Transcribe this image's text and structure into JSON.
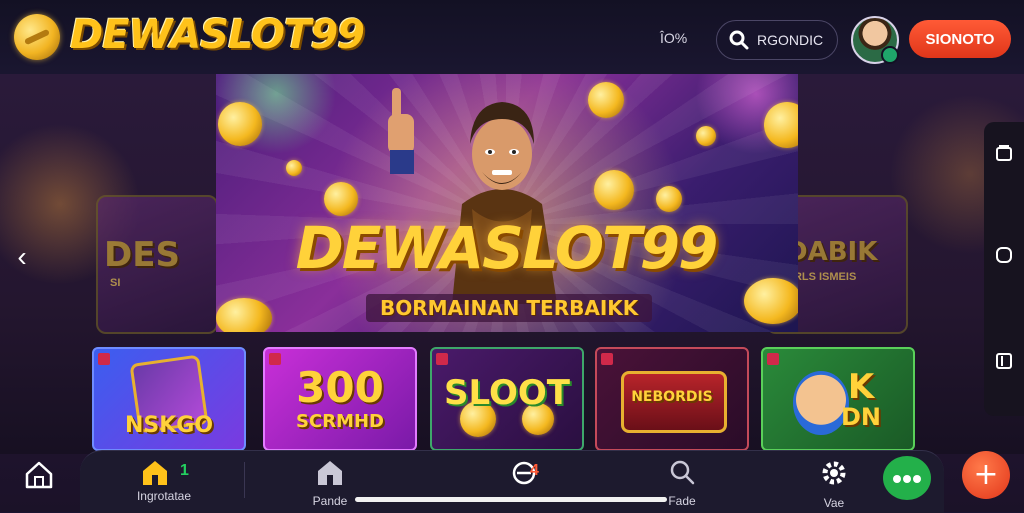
{
  "header": {
    "logo_text": "DEWASLOT99",
    "percent": "ÎO%",
    "search_label": "RGONDIC",
    "cta_label": "SIONOTO"
  },
  "hero": {
    "title": "DEWASLOT99",
    "subtitle": "BORMAINAN TERBAIKK"
  },
  "side_cards": {
    "left_title": "DES",
    "left_sub": "SI",
    "right_title": "DABIK",
    "right_sub": "BRLS ISMEIS"
  },
  "games": [
    {
      "title": "NSKGO"
    },
    {
      "title": "300",
      "sub": "SCRMHD"
    },
    {
      "title": "SLOOT"
    },
    {
      "title": "NEBORDIS"
    },
    {
      "title": "K",
      "sub": "DN"
    }
  ],
  "bottom_nav": {
    "item1_label": "Ingrotatae",
    "item1_badge": "1",
    "item2_label": "Pande",
    "item3_badge": "4",
    "item4_label": "Fade",
    "item5_label": "Vae"
  },
  "icons": {
    "search": "search-icon",
    "home": "home-icon",
    "settings": "gear-icon",
    "add": "plus-icon",
    "more": "more-icon",
    "back": "chevron-left-icon"
  },
  "colors": {
    "accent_gold": "#ffc21a",
    "cta_red": "#e0361a",
    "nav_bg": "#1d1a2e",
    "green": "#23b04a"
  }
}
